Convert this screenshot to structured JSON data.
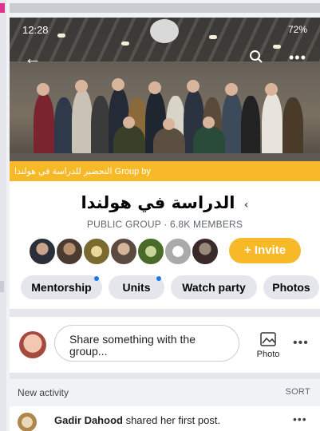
{
  "status_bar": {
    "time": "12:28",
    "battery": "72%"
  },
  "cover": {
    "banner_text": "التحضير للدراسة في هولندا Group by"
  },
  "group": {
    "name": "الدراسة في هولندا",
    "chevron": "‹",
    "meta": "PUBLIC GROUP · 6.8K MEMBERS",
    "invite_label": "+ Invite"
  },
  "chips": [
    {
      "label": "Mentorship",
      "dot": true
    },
    {
      "label": "Units",
      "dot": true
    },
    {
      "label": "Watch party",
      "dot": false
    },
    {
      "label": "Photos",
      "dot": false
    }
  ],
  "composer": {
    "placeholder": "Share something with the group...",
    "photo_label": "Photo"
  },
  "activity": {
    "title": "New activity",
    "sort_label": "SORT",
    "posts": [
      {
        "name": "Gadir Dahood",
        "action": "shared her first post."
      }
    ]
  },
  "colors": {
    "accent": "#f7b928",
    "chip_bg": "#e4e6eb",
    "dot": "#1877f2"
  }
}
